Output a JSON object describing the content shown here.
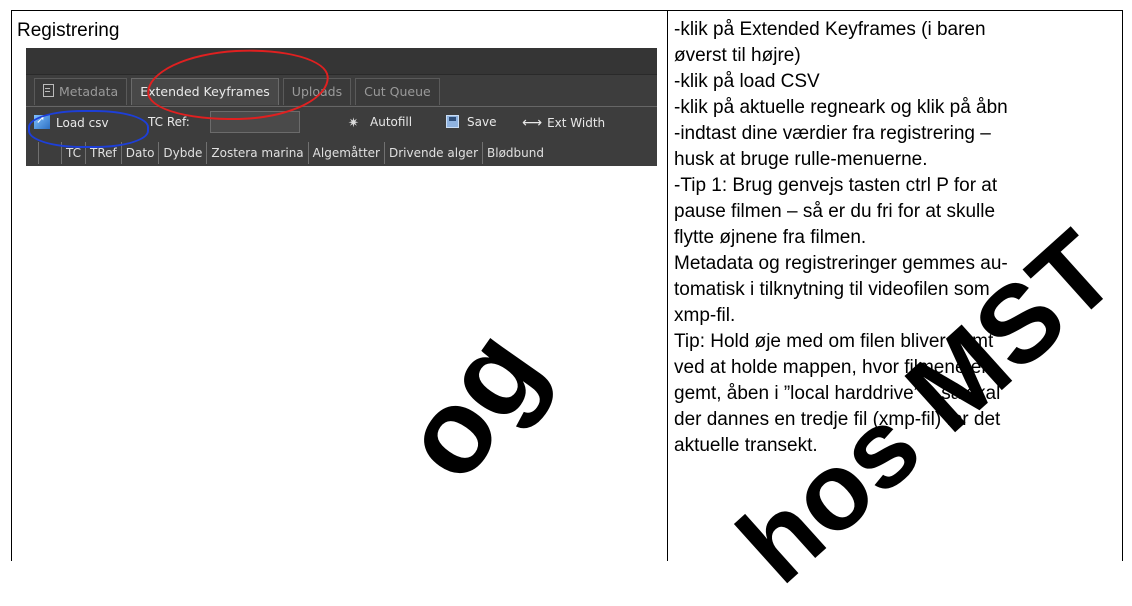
{
  "left": {
    "title": "Registrering"
  },
  "ui": {
    "tabs": [
      {
        "label": "Metadata"
      },
      {
        "label": "Extended Keyframes"
      },
      {
        "label": "Uploads"
      },
      {
        "label": "Cut Queue"
      }
    ],
    "toolbar": {
      "load_label": "Load csv",
      "tc_ref_label": "TC Ref:",
      "autofill_label": "Autofill",
      "save_label": "Save",
      "ext_width_label": "Ext Width"
    },
    "columns": [
      "TC",
      "TRef",
      "Dato",
      "Dybde",
      "Zostera marina",
      "Algemåtter",
      "Drivende alger",
      "Blødbund"
    ]
  },
  "right": {
    "lines": [
      "-klik på Extended Keyframes (i baren",
      "øverst til højre)",
      "-klik på load CSV",
      "-klik på aktuelle regneark og klik på åbn",
      "-indtast dine værdier fra registrering –",
      "husk at bruge rulle-menuerne.",
      "-Tip 1: Brug genvejs tasten ctrl P for at",
      "pause filmen – så er du fri for at skulle",
      "flytte øjnene fra filmen.",
      "Metadata og registreringer gemmes au-",
      "tomatisk i tilknytning til videofilen som",
      "xmp-fil.",
      "Tip: Hold øje med om filen bliver gemt",
      "ved at holde mappen, hvor filmene er",
      "gemt, åben i ”local harddrive” – så skal",
      "der dannes en tredje fil (xmp-fil) for det",
      "aktuelle transekt."
    ]
  },
  "watermark": {
    "text_1": "og",
    "text_2": "hos MST"
  }
}
